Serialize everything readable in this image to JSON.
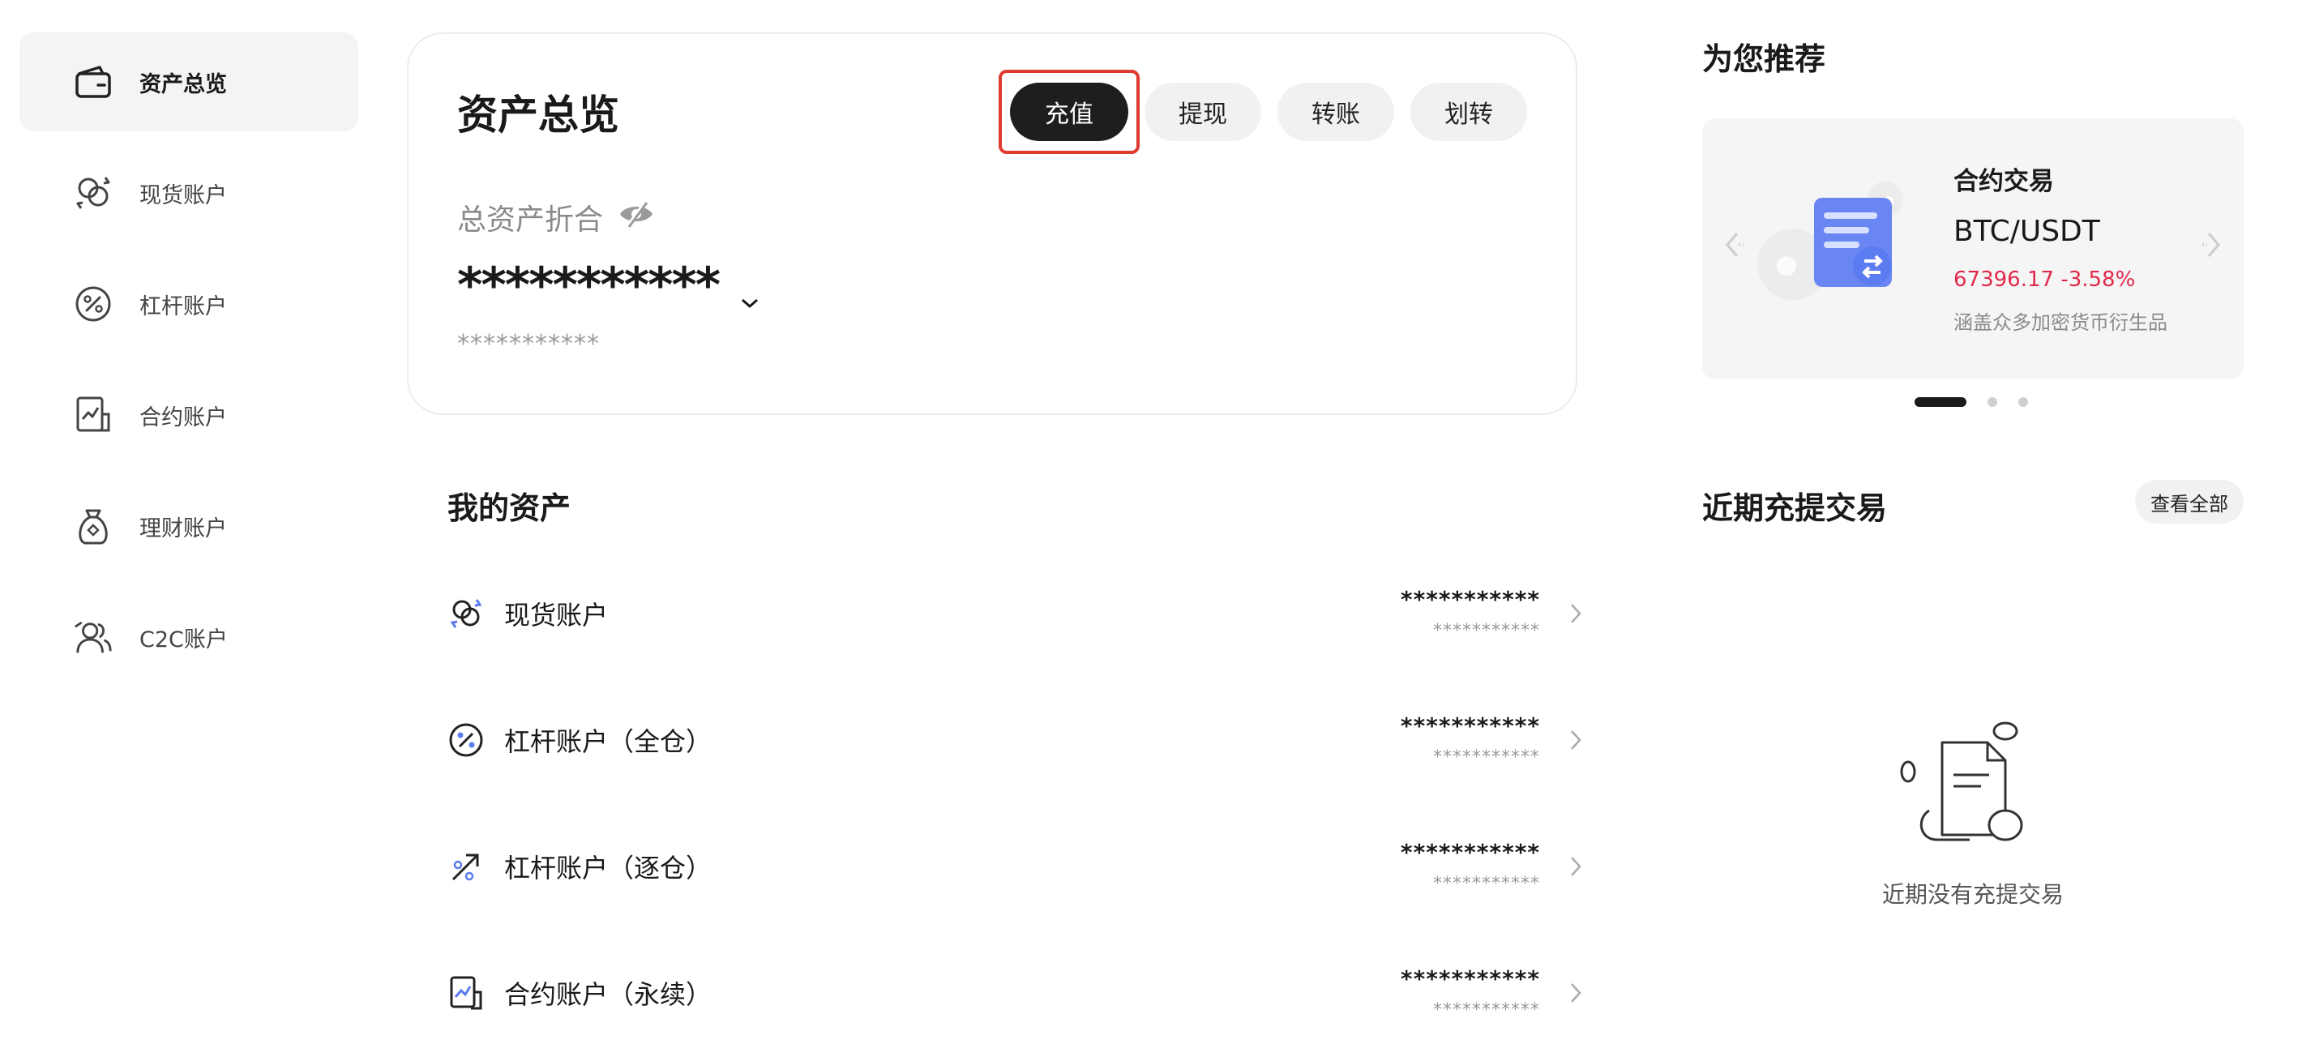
{
  "sidebar": {
    "items": [
      {
        "label": "资产总览",
        "icon": "wallet-icon",
        "active": true
      },
      {
        "label": "现货账户",
        "icon": "spot-coins-icon",
        "active": false
      },
      {
        "label": "杠杆账户",
        "icon": "margin-percent-icon",
        "active": false
      },
      {
        "label": "合约账户",
        "icon": "futures-chart-icon",
        "active": false
      },
      {
        "label": "理财账户",
        "icon": "money-bag-icon",
        "active": false
      },
      {
        "label": "C2C账户",
        "icon": "users-icon",
        "active": false
      }
    ]
  },
  "overview": {
    "title": "资产总览",
    "buttons": {
      "deposit": "充值",
      "withdraw": "提现",
      "transfer": "转账",
      "internal_transfer": "划转"
    },
    "total_label": "总资产折合",
    "total_value": "***********",
    "total_sub": "***********"
  },
  "assets": {
    "title": "我的资产",
    "rows": [
      {
        "name": "现货账户",
        "value": "***********",
        "sub": "***********",
        "icon": "spot-coins-icon"
      },
      {
        "name": "杠杆账户（全仓）",
        "value": "***********",
        "sub": "***********",
        "icon": "margin-percent-icon"
      },
      {
        "name": "杠杆账户（逐仓）",
        "value": "***********",
        "sub": "***********",
        "icon": "isolated-margin-icon"
      },
      {
        "name": "合约账户（永续）",
        "value": "***********",
        "sub": "***********",
        "icon": "futures-chart-icon"
      }
    ]
  },
  "recommend": {
    "title": "为您推荐",
    "card": {
      "kind": "合约交易",
      "pair": "BTC/USDT",
      "price_change": "67396.17 -3.58%",
      "description": "涵盖众多加密货币衍生品"
    },
    "slide_count": 3,
    "active_slide": 0
  },
  "recent": {
    "title": "近期充提交易",
    "view_all": "查看全部",
    "empty_text": "近期没有充提交易"
  },
  "colors": {
    "primary_button": "#1e1e1e",
    "highlight_border": "#e03a2f",
    "negative": "#e0294a",
    "accent_blue": "#5b7cf0"
  }
}
